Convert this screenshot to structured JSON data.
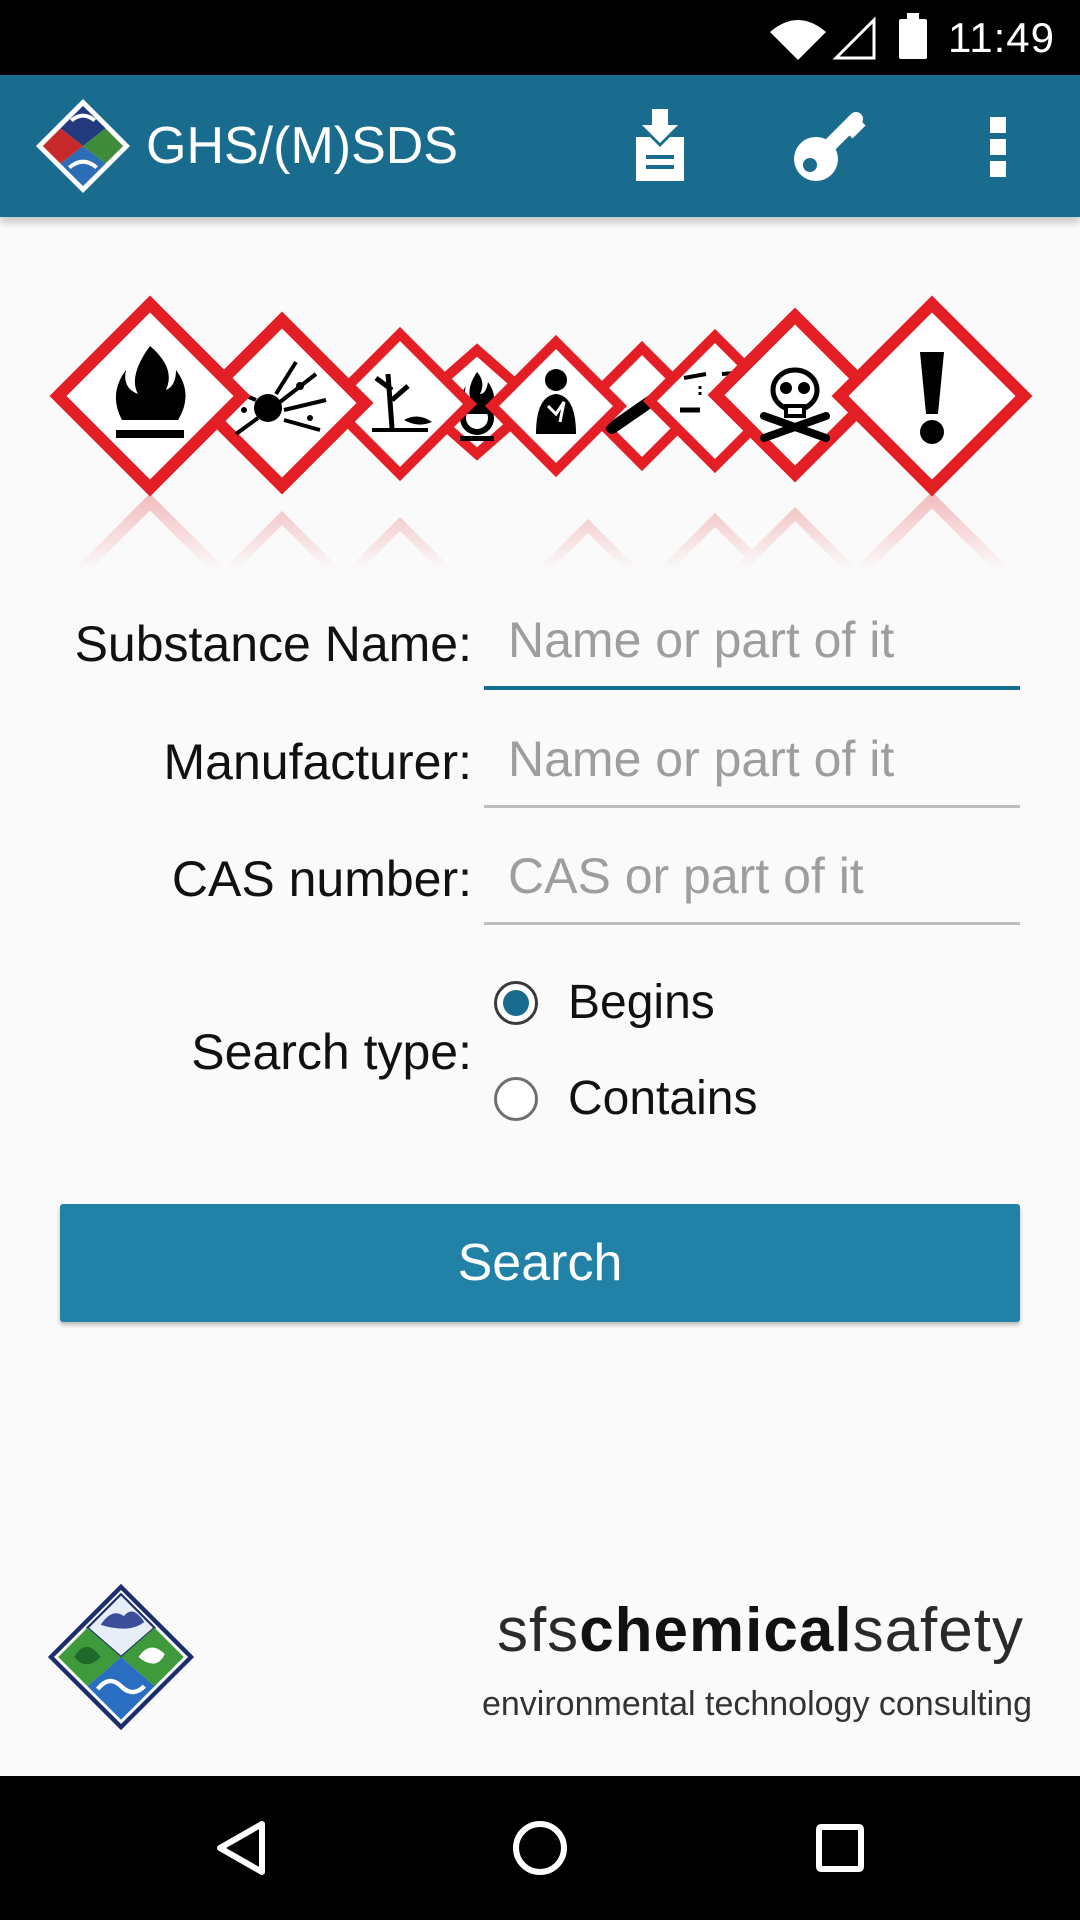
{
  "status_bar": {
    "time": "11:49",
    "icons": [
      "wifi-icon",
      "cell-signal-icon",
      "battery-icon"
    ]
  },
  "app_bar": {
    "title": "GHS/(M)SDS",
    "actions": [
      "download-sds-icon",
      "key-icon",
      "overflow-menu-icon"
    ]
  },
  "hazard_banner": {
    "pictograms": [
      "flame",
      "exploding-bomb",
      "environment",
      "flame-over-circle",
      "health-hazard",
      "gas-cylinder",
      "corrosion",
      "skull-and-crossbones",
      "exclamation-mark"
    ],
    "colors": {
      "border": "#E31E24",
      "fill": "#FFFFFF",
      "symbol": "#000000"
    }
  },
  "form": {
    "substance": {
      "label": "Substance Name:",
      "placeholder": "Name or part of it",
      "value": ""
    },
    "manufacturer": {
      "label": "Manufacturer:",
      "placeholder": "Name or part of it",
      "value": ""
    },
    "cas": {
      "label": "CAS number:",
      "placeholder": "CAS or part of it",
      "value": ""
    },
    "search_type": {
      "label": "Search type:",
      "options": [
        "Begins",
        "Contains"
      ],
      "selected": "Begins"
    },
    "search_button": "Search"
  },
  "footer": {
    "brand_prefix": "sfs",
    "brand_bold": "chemical",
    "brand_suffix": "safety",
    "tagline": "environmental technology consulting"
  },
  "nav_bar": {
    "buttons": [
      "back-icon",
      "home-icon",
      "recents-icon"
    ]
  },
  "colors": {
    "accent": "#1A6C8F",
    "button": "#2181A6",
    "background": "#FAFAFA"
  }
}
